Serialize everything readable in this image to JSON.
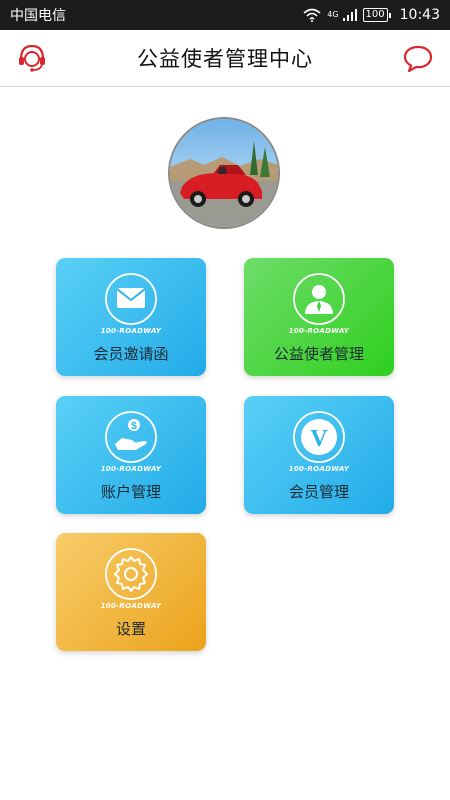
{
  "status_bar": {
    "carrier": "中国电信",
    "network": "4G",
    "battery": "100",
    "time": "10:43"
  },
  "header": {
    "title": "公益使者管理中心",
    "left_icon": "customer-service-icon",
    "right_icon": "chat-bubble-icon",
    "accent_color": "#d9262c"
  },
  "avatar": {
    "icon": "car-photo"
  },
  "tiles": [
    {
      "label": "会员邀请函",
      "brand": "100-ROADWAY",
      "icon": "envelope-icon",
      "color": "#2bb3ec"
    },
    {
      "label": "公益使者管理",
      "brand": "100-ROADWAY",
      "icon": "person-icon",
      "color": "#3fd335"
    },
    {
      "label": "账户管理",
      "brand": "100-ROADWAY",
      "icon": "money-hand-icon",
      "color": "#2bb3ec"
    },
    {
      "label": "会员管理",
      "brand": "100-ROADWAY",
      "icon": "v-badge-icon",
      "color": "#2bb3ec"
    },
    {
      "label": "设置",
      "brand": "100-ROADWAY",
      "icon": "gear-icon",
      "color": "#f0ac2a"
    }
  ]
}
